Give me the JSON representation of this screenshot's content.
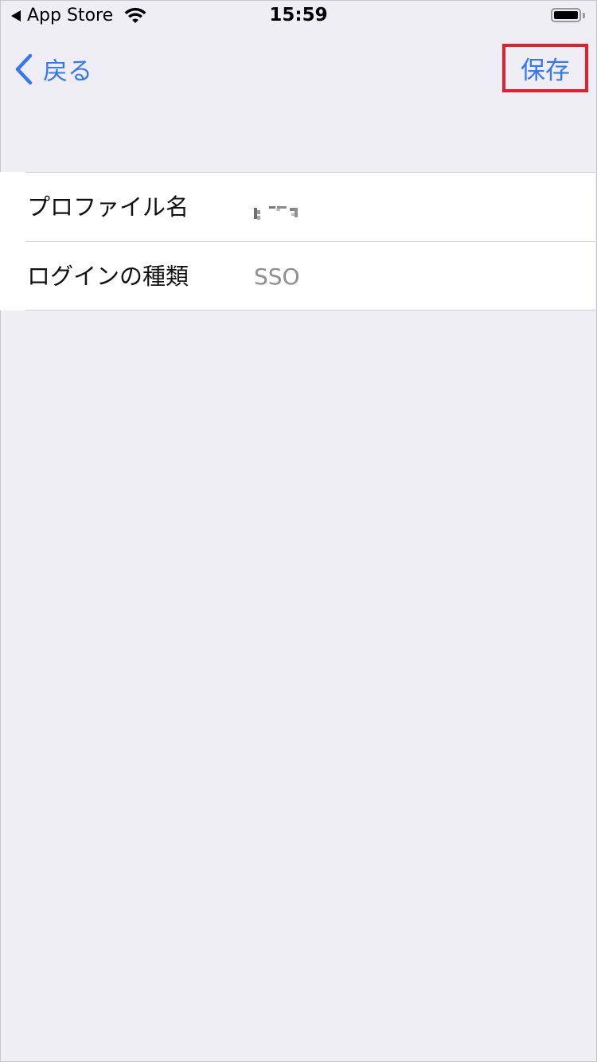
{
  "status_bar": {
    "back_app": "App Store",
    "time": "15:59"
  },
  "nav": {
    "back_label": "戻る",
    "save_label": "保存"
  },
  "form": {
    "rows": [
      {
        "label": "プロファイル名",
        "value": ""
      },
      {
        "label": "ログインの種類",
        "value": "SSO"
      }
    ]
  },
  "colors": {
    "accent": "#3478f6",
    "highlight": "#e61e2a",
    "background": "#efeef4"
  },
  "icons": [
    "back-triangle-icon",
    "wifi-icon",
    "battery-icon",
    "chevron-left-icon"
  ]
}
